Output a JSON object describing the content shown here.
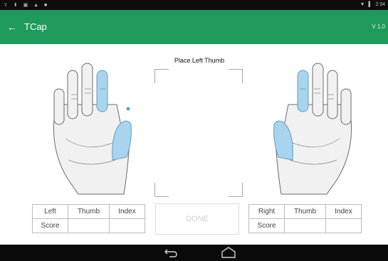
{
  "status_bar": {
    "left_icons": "⇧ ⬆ ▣ ▲ ■",
    "signal_icon": "▼",
    "battery_icon": "▌",
    "time": "2:34"
  },
  "app_bar": {
    "back_icon": "←",
    "title": "TCap",
    "version": "V 1.0"
  },
  "capture": {
    "instruction": "Place Left Thumb",
    "done_label": "DONE"
  },
  "left_table": {
    "row1": [
      "Left",
      "Thumb",
      "Index"
    ],
    "row2": [
      "Score",
      "",
      ""
    ]
  },
  "right_table": {
    "row1": [
      "Right",
      "Thumb",
      "Index"
    ],
    "row2": [
      "Score",
      "",
      ""
    ]
  },
  "colors": {
    "app_bar": "#1f9a5b",
    "finger_highlight": "#a8d4ee",
    "status_bar": "#0d0d0d",
    "nav_bar": "#0a0a0a"
  }
}
